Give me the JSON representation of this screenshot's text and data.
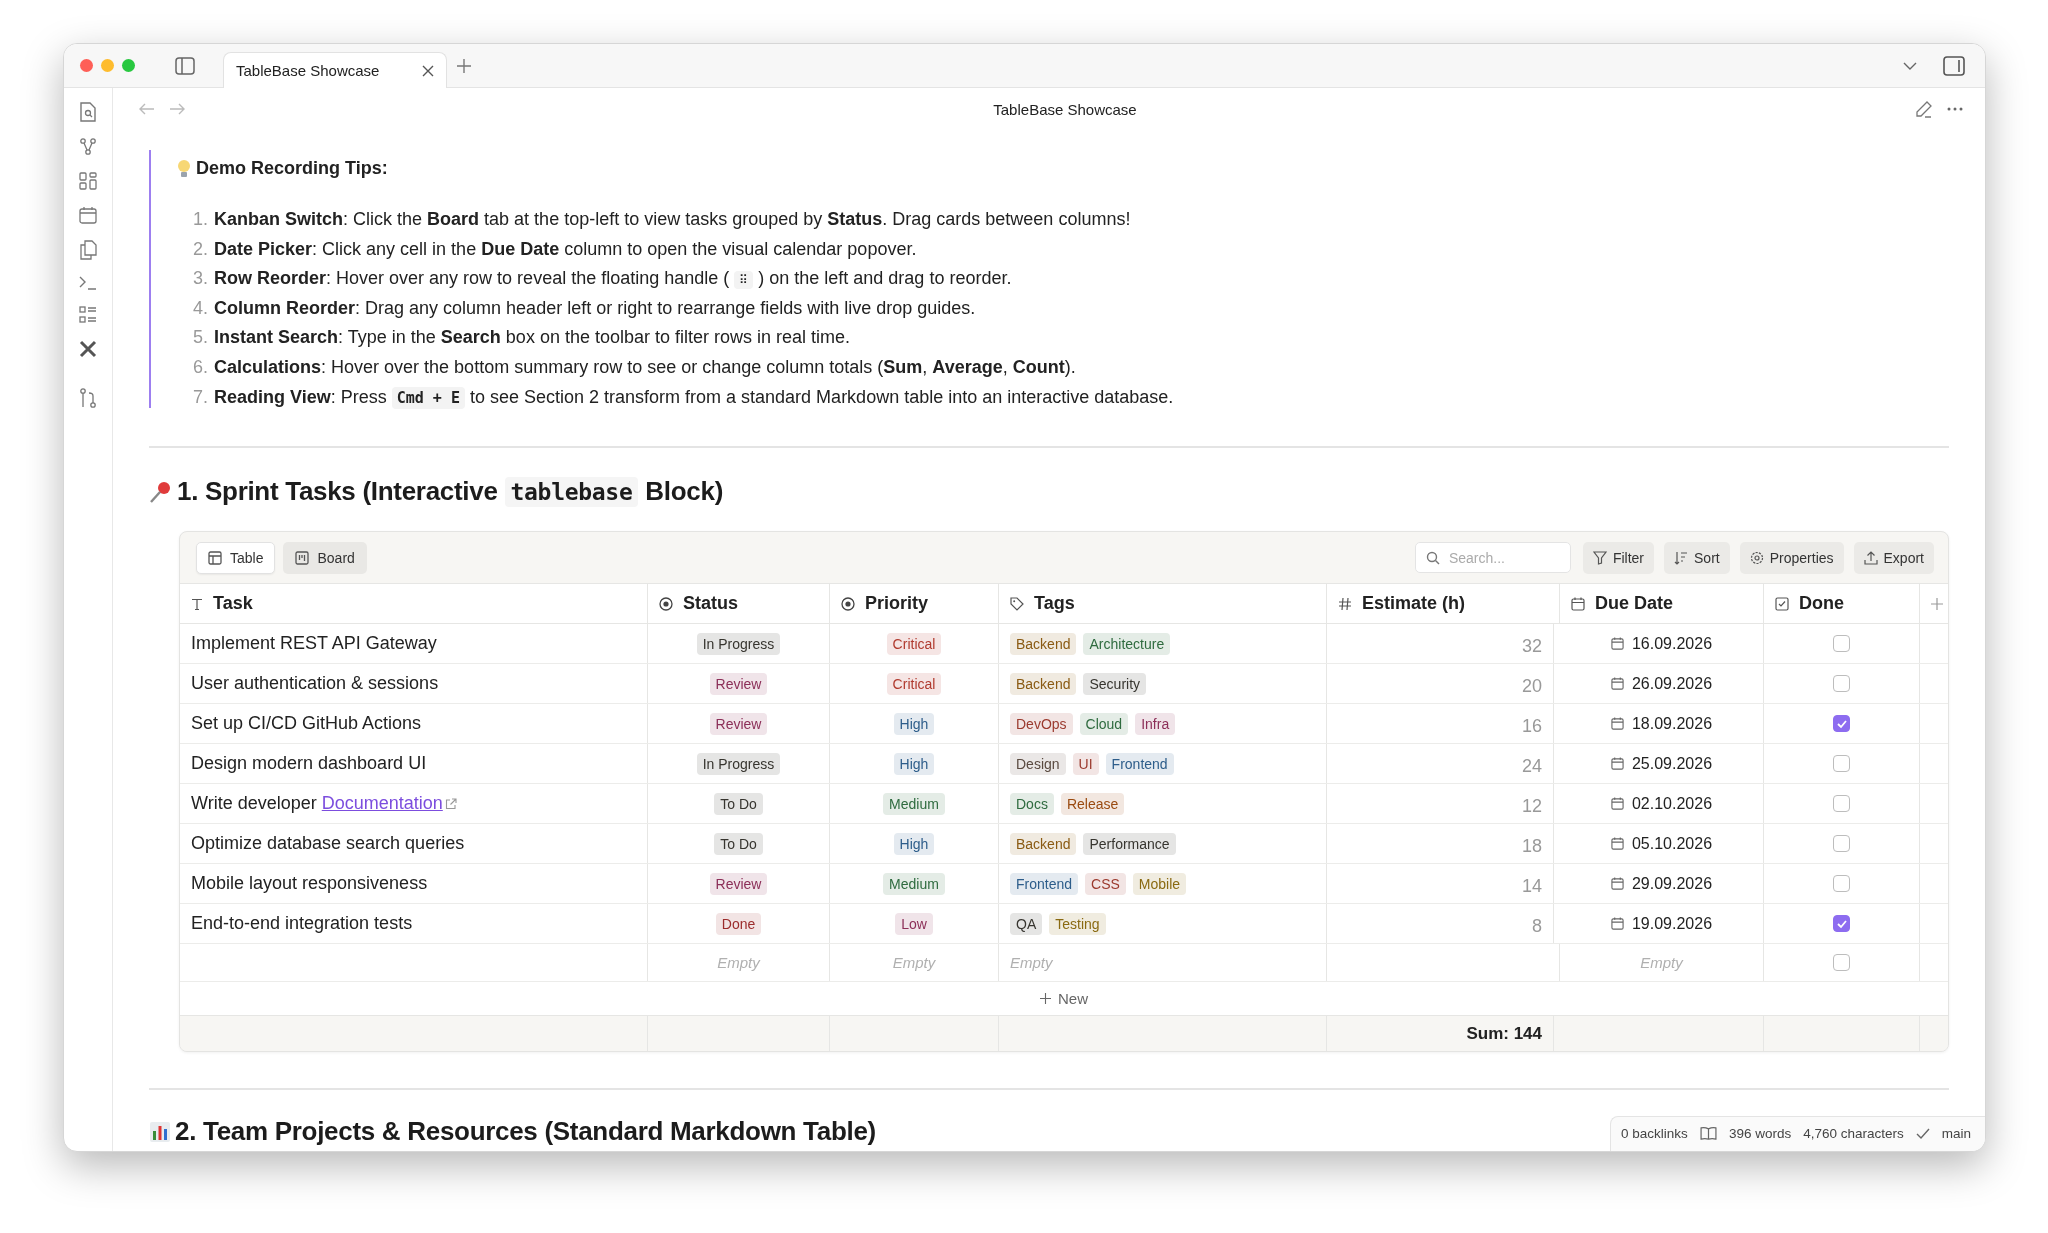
{
  "window": {
    "tab_title": "TableBase Showcase",
    "title": "TableBase Showcase"
  },
  "tips": {
    "title": "Demo Recording Tips:",
    "items": [
      {
        "number": "1.",
        "segments": [
          {
            "kind": "text",
            "text": "**Kanban Switch**: Click the **Board** tab at the top-left to view tasks grouped by **Status**. Drag cards between columns!"
          }
        ]
      },
      {
        "number": "2.",
        "segments": [
          {
            "kind": "text",
            "text": "**Date Picker**: Click any cell in the **Due Date** column to open the visual calendar popover."
          }
        ]
      },
      {
        "number": "3.",
        "segments": [
          {
            "kind": "text",
            "text": "**Row Reorder**: Hover over any row to reveal the floating handle ( "
          },
          {
            "kind": "code",
            "text": "⠿"
          },
          {
            "kind": "text",
            "text": " ) on the left and drag to reorder."
          }
        ]
      },
      {
        "number": "4.",
        "segments": [
          {
            "kind": "text",
            "text": "**Column Reorder**: Drag any column header left or right to rearrange fields with live drop guides."
          }
        ]
      },
      {
        "number": "5.",
        "segments": [
          {
            "kind": "text",
            "text": "**Instant Search**: Type in the **Search** box on the toolbar to filter rows in real time."
          }
        ]
      },
      {
        "number": "6.",
        "segments": [
          {
            "kind": "text",
            "text": "**Calculations**: Hover over the bottom summary row to see or change column totals (**Sum**, **Average**, **Count**)."
          }
        ]
      },
      {
        "number": "7.",
        "segments": [
          {
            "kind": "text",
            "text": "**Reading View**: Press "
          },
          {
            "kind": "code",
            "text": "Cmd + E"
          },
          {
            "kind": "text",
            "text": " to see Section 2 transform from a standard Markdown table into an interactive database."
          }
        ]
      }
    ]
  },
  "section1": {
    "segments": [
      {
        "kind": "text",
        "text": "1. Sprint Tasks (Interactive "
      },
      {
        "kind": "code",
        "text": "tablebase"
      },
      {
        "kind": "text",
        "text": " Block)"
      }
    ]
  },
  "table": {
    "views": [
      {
        "kind": "table",
        "label": "Table",
        "selected": true
      },
      {
        "kind": "board",
        "label": "Board",
        "selected": false
      }
    ],
    "search": {
      "placeholder": "Search..."
    },
    "actions": [
      {
        "kind": "filter",
        "label": "Filter"
      },
      {
        "kind": "sort",
        "label": "Sort"
      },
      {
        "kind": "properties",
        "label": "Properties"
      },
      {
        "kind": "export",
        "label": "Export"
      }
    ],
    "columns": [
      {
        "kind": "text",
        "label": "Task"
      },
      {
        "kind": "status",
        "label": "Status"
      },
      {
        "kind": "select",
        "label": "Priority"
      },
      {
        "kind": "tags",
        "label": "Tags"
      },
      {
        "kind": "number",
        "label": "Estimate (h)"
      },
      {
        "kind": "date",
        "label": "Due Date"
      },
      {
        "kind": "checkbox",
        "label": "Done"
      }
    ],
    "rows": [
      {
        "task": "Implement REST API Gateway",
        "status": {
          "label": "In Progress",
          "color": "#37352f"
        },
        "priority": {
          "label": "Critical",
          "color": "#b03a2e"
        },
        "tags": [
          {
            "label": "Backend",
            "color": "#8a5a12"
          },
          {
            "label": "Architecture",
            "color": "#2f6b3f"
          }
        ],
        "estimate": "32",
        "due": "16.09.2026",
        "done": false
      },
      {
        "task": "User authentication & sessions",
        "status": {
          "label": "Review",
          "color": "#8c2f58"
        },
        "priority": {
          "label": "Critical",
          "color": "#b03a2e"
        },
        "tags": [
          {
            "label": "Backend",
            "color": "#8a5a12"
          },
          {
            "label": "Security",
            "color": "#37352f"
          }
        ],
        "estimate": "20",
        "due": "26.09.2026",
        "done": false
      },
      {
        "task": "Set up CI/CD GitHub Actions",
        "status": {
          "label": "Review",
          "color": "#8c2f58"
        },
        "priority": {
          "label": "High",
          "color": "#2d5d8a"
        },
        "tags": [
          {
            "label": "DevOps",
            "color": "#9b3a2e"
          },
          {
            "label": "Cloud",
            "color": "#2f6b3f"
          },
          {
            "label": "Infra",
            "color": "#8c2f58"
          }
        ],
        "estimate": "16",
        "due": "18.09.2026",
        "done": true
      },
      {
        "task": "Design modern dashboard UI",
        "status": {
          "label": "In Progress",
          "color": "#37352f"
        },
        "priority": {
          "label": "High",
          "color": "#2d5d8a"
        },
        "tags": [
          {
            "label": "Design",
            "color": "#5a4a40"
          },
          {
            "label": "UI",
            "color": "#9b3a2e"
          },
          {
            "label": "Frontend",
            "color": "#2d5d8a"
          }
        ],
        "estimate": "24",
        "due": "25.09.2026",
        "done": false
      },
      {
        "task": "Write developer ",
        "link": "Documentation",
        "status": {
          "label": "To Do",
          "color": "#37352f"
        },
        "priority": {
          "label": "Medium",
          "color": "#2f6b3f"
        },
        "tags": [
          {
            "label": "Docs",
            "color": "#2f6b3f"
          },
          {
            "label": "Release",
            "color": "#9a4a10"
          }
        ],
        "estimate": "12",
        "due": "02.10.2026",
        "done": false
      },
      {
        "task": "Optimize database search queries",
        "status": {
          "label": "To Do",
          "color": "#37352f"
        },
        "priority": {
          "label": "High",
          "color": "#2d5d8a"
        },
        "tags": [
          {
            "label": "Backend",
            "color": "#8a5a12"
          },
          {
            "label": "Performance",
            "color": "#37352f"
          }
        ],
        "estimate": "18",
        "due": "05.10.2026",
        "done": false
      },
      {
        "task": "Mobile layout responsiveness",
        "status": {
          "label": "Review",
          "color": "#8c2f58"
        },
        "priority": {
          "label": "Medium",
          "color": "#2f6b3f"
        },
        "tags": [
          {
            "label": "Frontend",
            "color": "#2d5d8a"
          },
          {
            "label": "CSS",
            "color": "#9b3a2e"
          },
          {
            "label": "Mobile",
            "color": "#8a6a12"
          }
        ],
        "estimate": "14",
        "due": "29.09.2026",
        "done": false
      },
      {
        "task": "End-to-end integration tests",
        "status": {
          "label": "Done",
          "color": "#9b2c2c"
        },
        "priority": {
          "label": "Low",
          "color": "#8c2f58"
        },
        "tags": [
          {
            "label": "QA",
            "color": "#37352f"
          },
          {
            "label": "Testing",
            "color": "#8a6a12"
          }
        ],
        "estimate": "8",
        "due": "19.09.2026",
        "done": true
      }
    ],
    "empty_row": {
      "status": "Empty",
      "priority": "Empty",
      "tags": "Empty",
      "due": "Empty",
      "done": false
    },
    "new_label": "New",
    "summary": {
      "estimate": "Sum: 144"
    }
  },
  "section2": {
    "title": "2. Team Projects & Resources (Standard Markdown Table)"
  },
  "status_bar": {
    "backlinks": "0 backlinks",
    "words": "396 words",
    "characters": "4,760 characters",
    "branch": "main"
  }
}
